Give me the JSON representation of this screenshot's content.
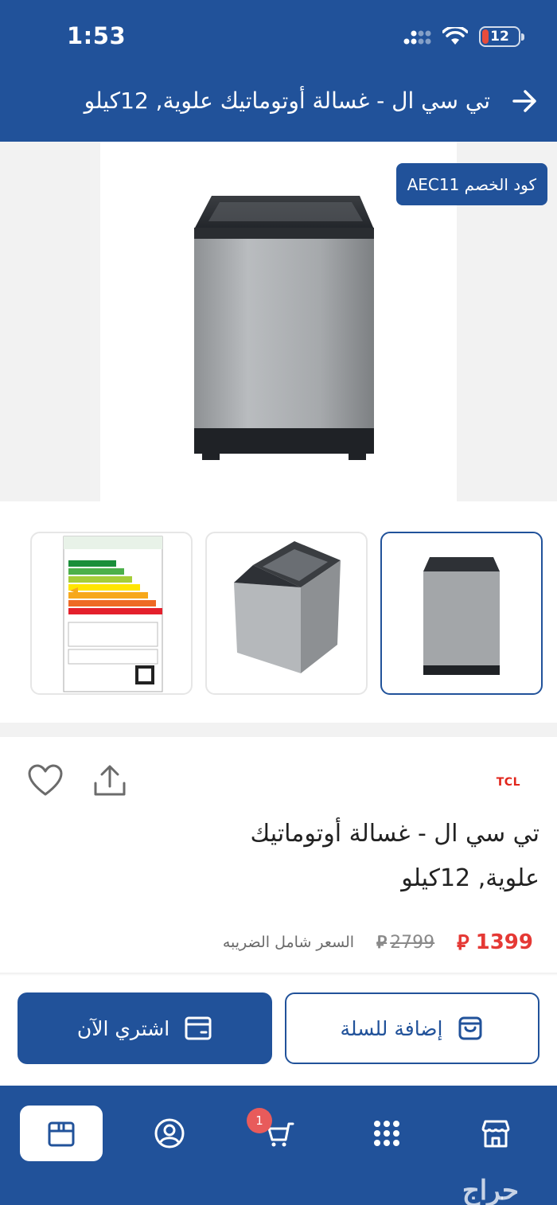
{
  "status_bar": {
    "time": "1:53",
    "battery": "12"
  },
  "header": {
    "title": "تي سي ال - غسالة أوتوماتيك علوية, 12كيلو"
  },
  "coupon": {
    "text": "كود الخصم AEC11"
  },
  "product": {
    "brand": "TCL",
    "title": "تي سي ال - غسالة أوتوماتيك علوية, 12كيلو",
    "price": "1399",
    "old_price": "2799",
    "currency_symbol": "⃁",
    "tax_note": "السعر شامل الضريبه"
  },
  "actions": {
    "add_to_cart": "إضافة للسلة",
    "buy_now": "اشتري الآن"
  },
  "nav": {
    "cart_count": "1"
  },
  "watermark": "حراج",
  "colors": {
    "primary": "#21529a",
    "price": "#e53935",
    "brand": "#e1251b"
  },
  "icons": [
    "back-arrow-icon",
    "heart-icon",
    "share-icon",
    "cart-bag-icon",
    "card-icon",
    "box-icon",
    "user-icon",
    "cart-icon",
    "grid-icon",
    "store-icon"
  ]
}
